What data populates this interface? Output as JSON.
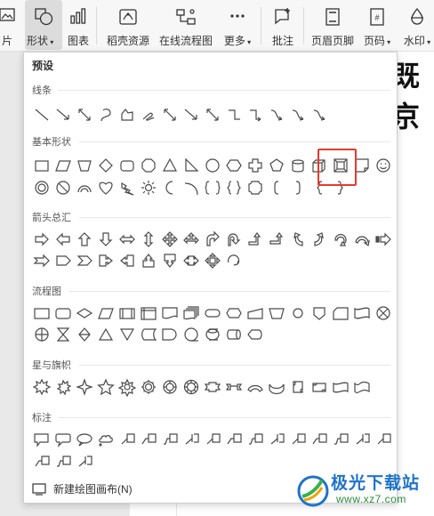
{
  "ribbon": {
    "items": [
      {
        "label": "片",
        "icon": "picture-icon"
      },
      {
        "label": "形状",
        "icon": "shapes-icon",
        "dropdown": true
      },
      {
        "label": "图表",
        "icon": "chart-icon"
      },
      {
        "label": "稻壳资源",
        "icon": "docer-resource-icon"
      },
      {
        "label": "在线流程图",
        "icon": "flowchart-icon"
      },
      {
        "label": "更多",
        "icon": "more-icon",
        "dropdown": true
      },
      {
        "label": "批注",
        "icon": "comment-icon"
      },
      {
        "label": "页眉页脚",
        "icon": "header-footer-icon"
      },
      {
        "label": "页码",
        "icon": "page-number-icon",
        "dropdown": true
      },
      {
        "label": "水印",
        "icon": "watermark-icon",
        "dropdown": true
      }
    ]
  },
  "document": {
    "visible_text": "既京"
  },
  "panel": {
    "title": "预设",
    "sections": {
      "lines": "线条",
      "basic": "基本形状",
      "arrows": "箭头总汇",
      "flowchart": "流程图",
      "stars": "星与旗帜",
      "callouts": "标注"
    },
    "new_canvas": "新建绘图画布(N)"
  },
  "watermark": {
    "text": "极光下载站",
    "url": "www.xz7.com"
  },
  "colors": {
    "accent": "#e63a2e",
    "shape_stroke": "#4a4a4a",
    "brand_blue": "#1f73c9"
  }
}
